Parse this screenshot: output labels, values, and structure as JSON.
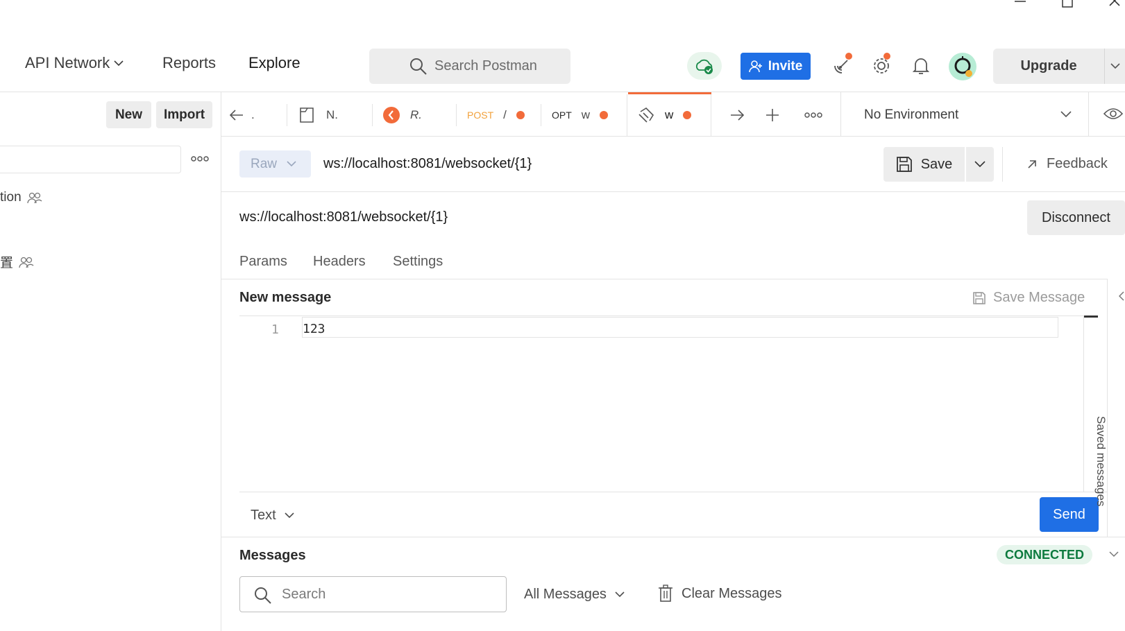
{
  "header": {
    "nav": [
      {
        "label": "API Network"
      },
      {
        "label": "Reports"
      },
      {
        "label": "Explore"
      }
    ],
    "search_placeholder": "Search Postman",
    "invite_label": "Invite",
    "upgrade_label": "Upgrade"
  },
  "sidebar": {
    "new_label": "New",
    "import_label": "Import",
    "items": [
      {
        "label": "tion"
      },
      {
        "label": "置"
      }
    ]
  },
  "tabs": [
    {
      "method": "",
      "label": "."
    },
    {
      "method": "",
      "label": "N."
    },
    {
      "method": "",
      "label": "R."
    },
    {
      "method": "POST",
      "label": "/"
    },
    {
      "method": "OPT",
      "label": "w"
    },
    {
      "method": "",
      "label": "w"
    }
  ],
  "environment": {
    "selected": "No Environment"
  },
  "request": {
    "mode": "Raw",
    "url": "ws://localhost:8081/websocket/{1}",
    "save_label": "Save",
    "feedback_label": "Feedback",
    "connected_url": "ws://localhost:8081/websocket/{1}",
    "disconnect_label": "Disconnect",
    "tabs": [
      "Params",
      "Headers",
      "Settings"
    ]
  },
  "new_message": {
    "title": "New message",
    "save_message_label": "Save Message",
    "lines": [
      {
        "num": "1",
        "text": "123"
      }
    ],
    "format": "Text",
    "send_label": "Send",
    "side_panel_label": "Saved messages"
  },
  "messages": {
    "title": "Messages",
    "status": "CONNECTED",
    "search_placeholder": "Search",
    "filter": "All Messages",
    "clear_label": "Clear Messages"
  },
  "colors": {
    "accent_blue": "#1f6fe5",
    "accent_orange": "#f26b3a",
    "connected_green": "#0d7a3e"
  }
}
